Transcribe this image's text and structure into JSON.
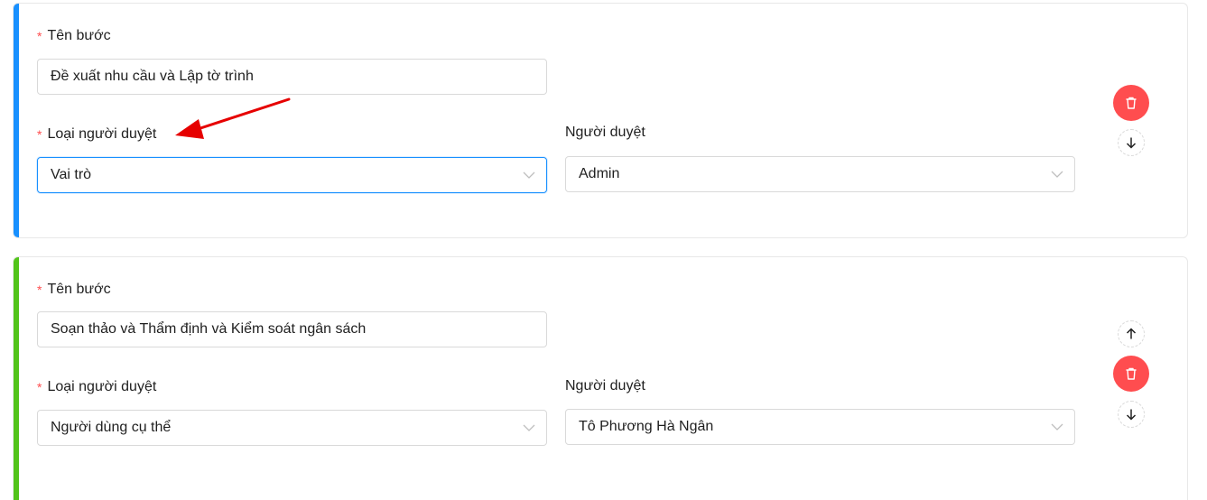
{
  "steps": [
    {
      "accent_color": "#1890ff",
      "step_name_label": "Tên bước",
      "step_name_value": "Đề xuất nhu cầu và Lập tờ trình",
      "approver_type_label": "Loại người duyệt",
      "approver_type_value": "Vai trò",
      "approver_label": "Người duyệt",
      "approver_value": "Admin"
    },
    {
      "accent_color": "#52c41a",
      "step_name_label": "Tên bước",
      "step_name_value": "Soạn thảo và Thẩm định và Kiểm soát ngân sách",
      "approver_type_label": "Loại người duyệt",
      "approver_type_value": "Người dùng cụ thể",
      "approver_label": "Người duyệt",
      "approver_value": "Tô Phương Hà Ngân"
    }
  ],
  "colors": {
    "required_mark": "#ff4d4f",
    "delete_button": "#ff4d4f",
    "focus_border": "#1890ff",
    "annotation_arrow": "#e60000"
  },
  "icons": {
    "delete": "trash-icon",
    "move_up": "arrow-up-icon",
    "move_down": "arrow-down-icon",
    "dropdown": "chevron-down-icon"
  }
}
